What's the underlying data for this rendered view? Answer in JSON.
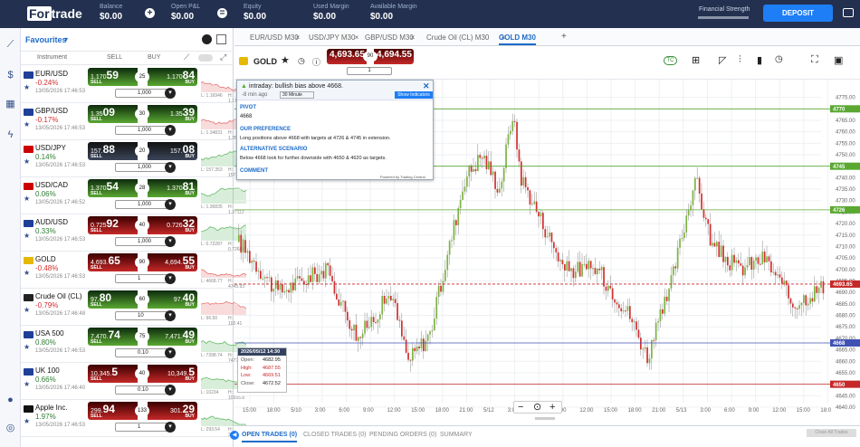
{
  "header": {
    "logo_a": "For",
    "logo_b": "trade",
    "balance_label": "Balance",
    "balance": "$0.00",
    "pnl_label": "Open P&L",
    "pnl": "$0.00",
    "equity_label": "Equity",
    "equity": "$0.00",
    "used_label": "Used Margin",
    "used": "$0.00",
    "avail_label": "Available Margin",
    "avail": "$0.00",
    "strength_label": "Financial Strength",
    "deposit": "DEPOSIT"
  },
  "watchlist": {
    "title": "Favourites",
    "col_instrument": "Instrument",
    "col_sell": "SELL",
    "col_buy": "BUY",
    "rows": [
      {
        "name": "EUR/USD",
        "change": "-0.24%",
        "date": "13/05/2026 17:46:53",
        "sell_a": "1.170",
        "sell_b": "59",
        "sell_c": "",
        "spread": "25",
        "buy_a": "1.170",
        "buy_b": "84",
        "buy_c": "",
        "qty": "1,000",
        "low": "L: 1.16946",
        "high": "H: 1.17408",
        "up": false,
        "flag": "#1f3f99",
        "theme": "green"
      },
      {
        "name": "GBP/USD",
        "change": "-0.17%",
        "date": "13/05/2026 17:46:53",
        "sell_a": "1.35",
        "sell_b": "09",
        "sell_c": "",
        "spread": "30",
        "buy_a": "1.35",
        "buy_b": "39",
        "buy_c": "",
        "qty": "1,000",
        "low": "L: 1.34831",
        "high": "H: 1.35648",
        "up": false,
        "flag": "#1f3f99",
        "theme": "green"
      },
      {
        "name": "USD/JPY",
        "change": "0.14%",
        "date": "13/05/2026 17:46:53",
        "sell_a": "157.",
        "sell_b": "88",
        "sell_c": "",
        "spread": "20",
        "buy_a": "157.",
        "buy_b": "08",
        "buy_c": "",
        "qty": "1,000",
        "low": "L: 157.353",
        "high": "H: 157.893",
        "up": true,
        "flag": "#c00",
        "theme": "grey"
      },
      {
        "name": "USD/CAD",
        "change": "0.06%",
        "date": "13/05/2026 17:46:52",
        "sell_a": "1.370",
        "sell_b": "54",
        "sell_c": "",
        "spread": "28",
        "buy_a": "1.370",
        "buy_b": "81",
        "buy_c": "",
        "qty": "1,000",
        "low": "L: 1.36835",
        "high": "H: 1.37113",
        "up": true,
        "flag": "#c00",
        "theme": "green"
      },
      {
        "name": "AUD/USD",
        "change": "0.33%",
        "date": "13/05/2026 17:46:53",
        "sell_a": "0.725",
        "sell_b": "92",
        "sell_c": "",
        "spread": "40",
        "buy_a": "0.726",
        "buy_b": "32",
        "buy_c": "",
        "qty": "1,000",
        "low": "L: 0.72287",
        "high": "H: 0.72688",
        "up": true,
        "flag": "#1f3f99",
        "theme": "red"
      },
      {
        "name": "GOLD",
        "change": "-0.48%",
        "date": "13/05/2026 17:46:53",
        "sell_a": "4,693.",
        "sell_b": "65",
        "sell_c": "",
        "spread": "90",
        "buy_a": "4,694.",
        "buy_b": "55",
        "buy_c": "",
        "qty": "1",
        "low": "L: 4668.77",
        "high": "H: 4745.93",
        "up": false,
        "flag": "#e6b800",
        "theme": "red"
      },
      {
        "name": "Crude Oil (CL)",
        "change": "-0.79%",
        "date": "13/05/2026 17:46:48",
        "sell_a": "97.",
        "sell_b": "80",
        "sell_c": "",
        "spread": "60",
        "buy_a": "97.",
        "buy_b": "40",
        "buy_c": "",
        "qty": "10",
        "low": "L: 96.50",
        "high": "H: 102.41",
        "up": false,
        "flag": "#222",
        "theme": "green"
      },
      {
        "name": "USA 500",
        "change": "0.80%",
        "date": "13/05/2026 17:46:53",
        "sell_a": "7,470.",
        "sell_b": "74",
        "sell_c": "",
        "spread": "75",
        "buy_a": "7,471.",
        "buy_b": "49",
        "buy_c": "",
        "qty": "0.10",
        "low": "L: 7398.74",
        "high": "H: 7472.11",
        "up": true,
        "flag": "#1f3f99",
        "theme": "green"
      },
      {
        "name": "UK 100",
        "change": "0.66%",
        "date": "13/05/2026 17:46:40",
        "sell_a": "10,345.",
        "sell_b": "5",
        "sell_c": "",
        "spread": "40",
        "buy_a": "10,349.",
        "buy_b": "5",
        "buy_c": "",
        "qty": "0.10",
        "low": "L: 10234",
        "high": "H: 10355.8",
        "up": true,
        "flag": "#1f3f99",
        "theme": "red"
      },
      {
        "name": "Apple Inc.",
        "change": "1.97%",
        "date": "13/05/2026 17:46:53",
        "sell_a": "299.",
        "sell_b": "94",
        "sell_c": "",
        "spread": "133",
        "buy_a": "301.",
        "buy_b": "29",
        "buy_c": "",
        "qty": "1",
        "low": "L: 293.54",
        "high": "H: 301.40",
        "up": true,
        "flag": "#111",
        "theme": "red"
      }
    ]
  },
  "tabs": [
    "EUR/USD M30",
    "USD/JPY M30",
    "GBP/USD M30",
    "Crude Oil (CL) M30",
    "GOLD M30"
  ],
  "chart": {
    "symbol": "GOLD",
    "sell": "4,693.65",
    "buy": "4,694.55",
    "spread": "90",
    "qty": "1",
    "sell_l": "SELL",
    "buy_l": "BUY",
    "tf": "M30"
  },
  "popup": {
    "headline": "intraday: bullish bias above 4668.",
    "age": "-8 min ago",
    "interval": "30 Minute",
    "show": "Show Indicators",
    "pivot_t": "PIVOT",
    "pivot": "4668",
    "pref_t": "OUR PREFERENCE",
    "pref": "Long positions above 4668 with targets at 4726 & 4745 in extension.",
    "alt_t": "ALTERNATIVE SCENARIO",
    "alt": "Below 4668 look for further downside with 4650 & 4620 as targets.",
    "comment_t": "COMMENT",
    "powered": "Powered by Trading Central"
  },
  "ohlc": {
    "date": "2026/05/12 14:30",
    "open_l": "Open:",
    "open": "4682.95",
    "high_l": "High:",
    "high": "4687.55",
    "low_l": "Low:",
    "low": "4669.51",
    "close_l": "Close:",
    "close": "4672.52"
  },
  "yaxis": [
    "4775.00",
    "4770.00",
    "4765.00",
    "4760.00",
    "4755.00",
    "4750.00",
    "4745.00",
    "4740.00",
    "4735.00",
    "4730.00",
    "4725.00",
    "4720.00",
    "4715.00",
    "4710.00",
    "4705.00",
    "4700.00",
    "4695.00",
    "4690.00",
    "4685.00",
    "4680.00",
    "4675.00",
    "4670.00",
    "4665.00",
    "4660.00",
    "4655.00",
    "4650.00",
    "4645.00",
    "4640.00"
  ],
  "levels": [
    {
      "v": "4770",
      "c": "#5aa832"
    },
    {
      "v": "4745",
      "c": "#5aa832"
    },
    {
      "v": "4726",
      "c": "#5aa832"
    },
    {
      "v": "4693.65",
      "c": "#c62828"
    },
    {
      "v": "4668",
      "c": "#3f51b5"
    },
    {
      "v": "4650",
      "c": "#c62828"
    }
  ],
  "xaxis": [
    "15:00",
    "18:00",
    "5/10",
    "3:00",
    "6:00",
    "9:00",
    "12:00",
    "15:00",
    "18:00",
    "21:00",
    "5/12",
    "3:00",
    "6:00",
    "9:00",
    "12:00",
    "15:00",
    "18:00",
    "21:00",
    "5/13",
    "3:00",
    "6:00",
    "9:00",
    "12:00",
    "15:00",
    "18:0"
  ],
  "bottom": {
    "open": "OPEN TRADES (0)",
    "closed": "CLOSED TRADES (0)",
    "pending": "PENDING ORDERS (0)",
    "summary": "SUMMARY",
    "close_all": "Close All Trades"
  },
  "colors": {
    "up": "#7cb342",
    "down": "#d32f2f",
    "navy": "#23304f",
    "accent": "#1e7ef5"
  }
}
